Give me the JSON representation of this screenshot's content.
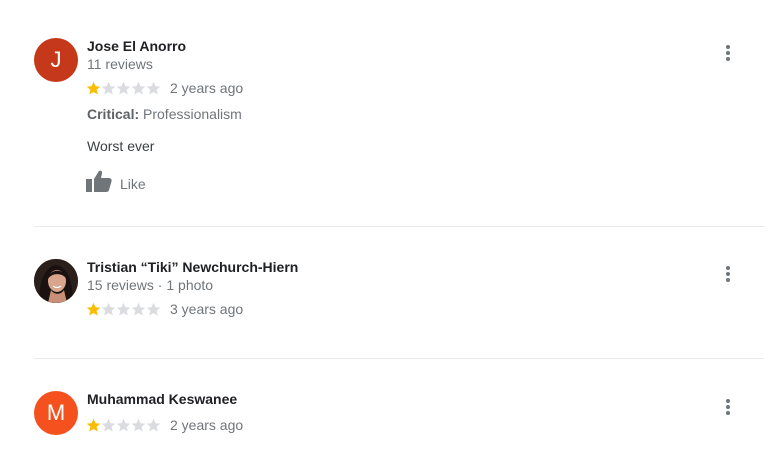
{
  "colors": {
    "star_filled": "#fbbc04",
    "star_empty": "#dadce0",
    "avatar_jose": "#c5391a",
    "avatar_muhammad": "#f4511e",
    "icon_grey": "#70757a"
  },
  "reviews": [
    {
      "avatar_letter": "J",
      "author": "Jose El Anorro",
      "meta": "11 reviews",
      "rating": 1,
      "max_rating": 5,
      "time": "2 years ago",
      "critical_label": "Critical:",
      "critical_value": "Professionalism",
      "text": "Worst ever",
      "like_label": "Like"
    },
    {
      "avatar_letter": "",
      "author": "Tristian “Tiki” Newchurch-Hiern",
      "meta": "15 reviews · 1 photo",
      "rating": 1,
      "max_rating": 5,
      "time": "3 years ago"
    },
    {
      "avatar_letter": "M",
      "author": "Muhammad Keswanee",
      "rating": 1,
      "max_rating": 5,
      "time": "2 years ago"
    }
  ],
  "icons": {
    "more": "more-vert-icon",
    "like": "thumb-up-icon",
    "star": "star-icon"
  }
}
